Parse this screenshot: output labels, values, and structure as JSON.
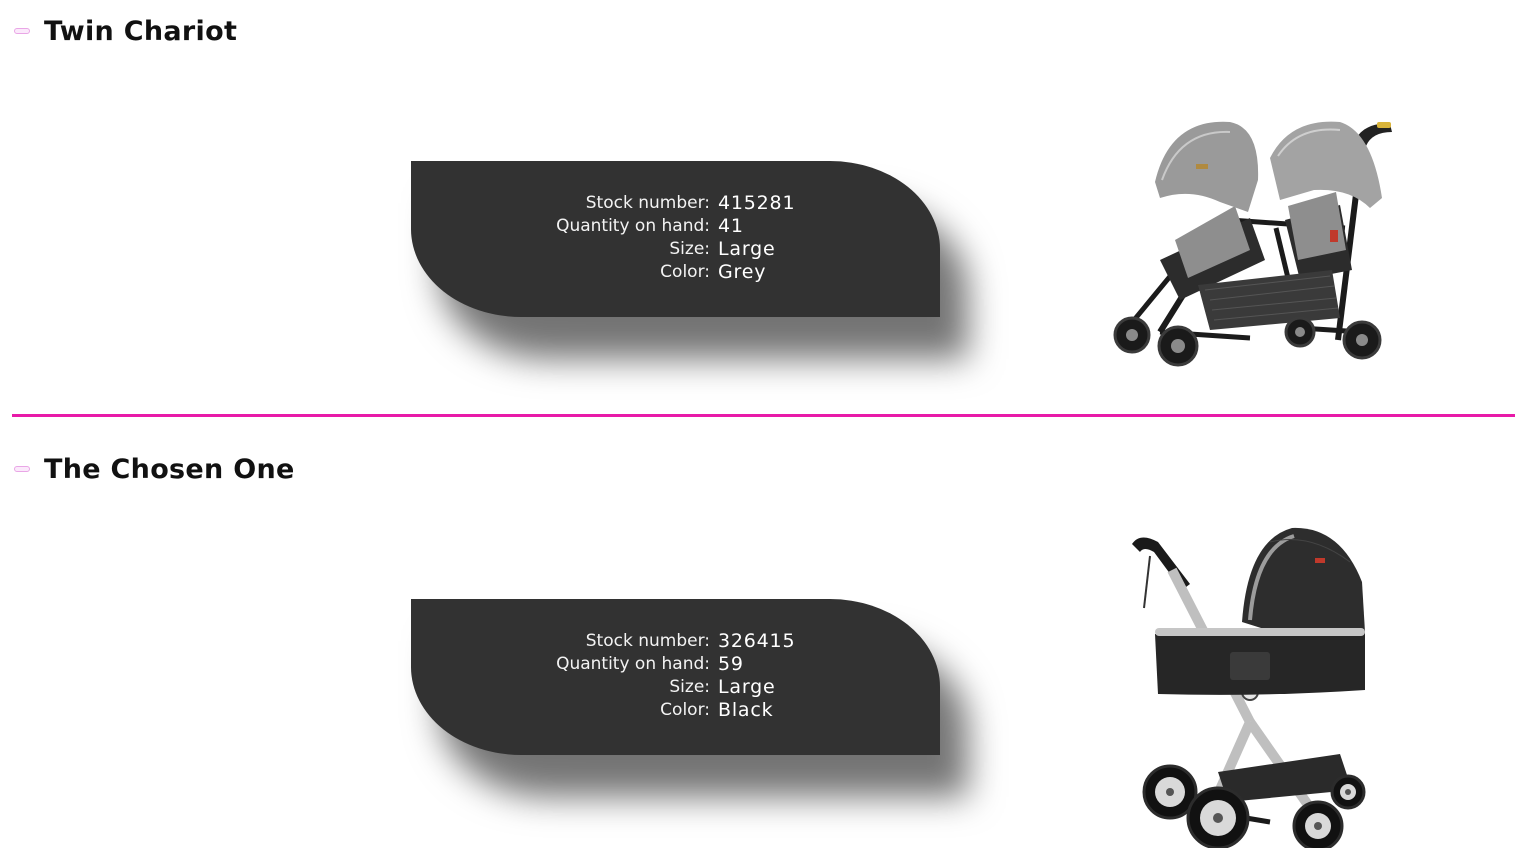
{
  "products": [
    {
      "name": "Twin Chariot",
      "image_icon": "double-stroller-image",
      "details": [
        {
          "label": "Stock number:",
          "value": "415281"
        },
        {
          "label": "Quantity on hand:",
          "value": "41"
        },
        {
          "label": "Size:",
          "value": "Large"
        },
        {
          "label": "Color:",
          "value": "Grey"
        }
      ]
    },
    {
      "name": "The Chosen One",
      "image_icon": "pram-stroller-image",
      "details": [
        {
          "label": "Stock number:",
          "value": "326415"
        },
        {
          "label": "Quantity on hand:",
          "value": "59"
        },
        {
          "label": "Size:",
          "value": "Large"
        },
        {
          "label": "Color:",
          "value": "Black"
        }
      ]
    }
  ],
  "colors": {
    "card_background": "#323232",
    "divider": "#e81aa8",
    "collapse_icon": "#e9a6e6",
    "title_text": "#111111"
  },
  "icons": {
    "collapse": "minus-collapse-icon"
  }
}
